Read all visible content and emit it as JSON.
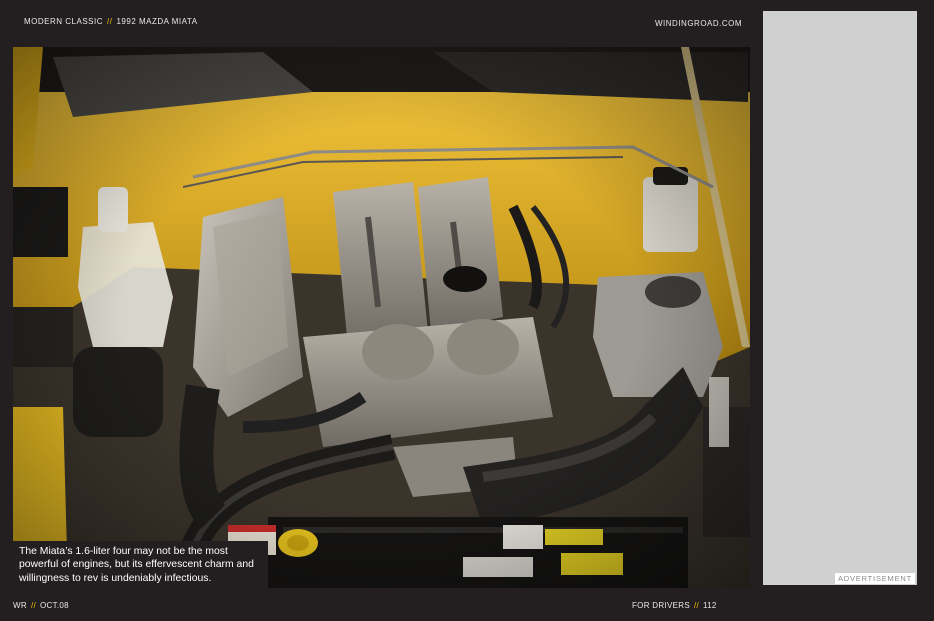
{
  "header": {
    "section": "MODERN CLASSIC",
    "separator": "//",
    "article": "1992 MAZDA MIATA",
    "site": "WINDINGROAD.COM"
  },
  "photo": {
    "caption": "The Miata’s 1.6-liter four may not be the most powerful of engines, but its effervescent charm and willingness to rev is undeniably infectious."
  },
  "ad": {
    "label": "ADVERTISEMENT"
  },
  "footer": {
    "publication": "WR",
    "separator": "//",
    "issue": "OCT.08",
    "section": "FOR DRIVERS",
    "page": "112"
  },
  "colors": {
    "background": "#231f20",
    "accent": "#f2c200",
    "car_paint": "#e8b51c",
    "ad_panel": "#d0d0d0"
  }
}
